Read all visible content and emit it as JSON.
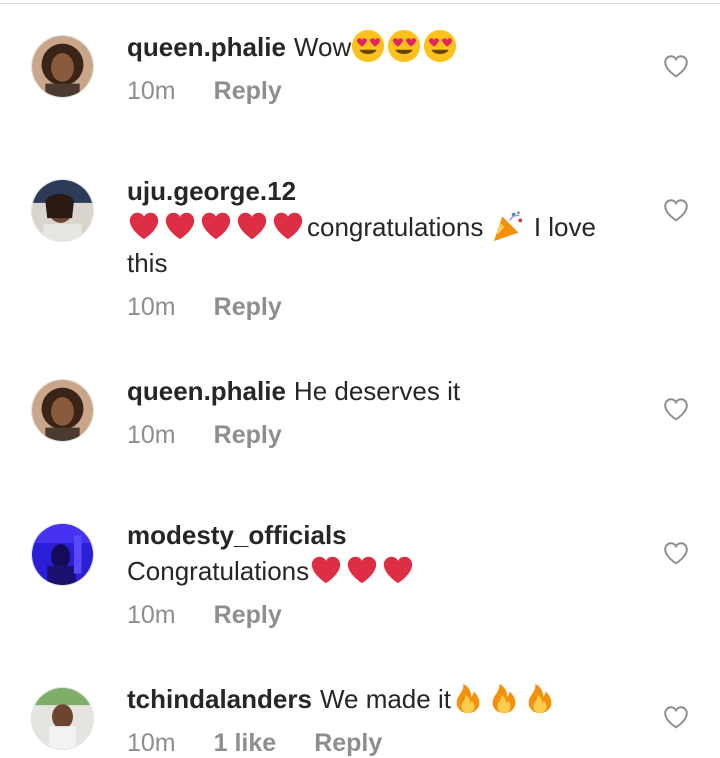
{
  "comments": [
    {
      "username": "queen.phalie",
      "text": "Wow",
      "emojis": [
        "heart-eyes",
        "heart-eyes",
        "heart-eyes"
      ],
      "time": "10m",
      "likes": "",
      "reply": "Reply"
    },
    {
      "username": "uju.george.12",
      "text_before": "",
      "emojis": [
        "red-heart",
        "red-heart",
        "red-heart",
        "red-heart",
        "red-heart"
      ],
      "text": "congratulations",
      "text_after": "I love this",
      "time": "10m",
      "likes": "",
      "reply": "Reply"
    },
    {
      "username": "queen.phalie",
      "text": "He deserves it",
      "time": "10m",
      "likes": "",
      "reply": "Reply"
    },
    {
      "username": "modesty_officials",
      "text": "Congratulations",
      "emojis": [
        "red-heart",
        "red-heart",
        "red-heart"
      ],
      "time": "10m",
      "likes": "",
      "reply": "Reply"
    },
    {
      "username": "tchindalanders",
      "text": "We made it",
      "emojis": [
        "fire",
        "fire",
        "fire"
      ],
      "time": "10m",
      "likes": "1 like",
      "reply": "Reply"
    }
  ],
  "colors": {
    "text": "#262626",
    "meta": "#8e8e8e",
    "heart_outline": "#8e8e8e"
  },
  "icons": {
    "like": "heart-outline-icon",
    "party": "party-popper-icon"
  }
}
